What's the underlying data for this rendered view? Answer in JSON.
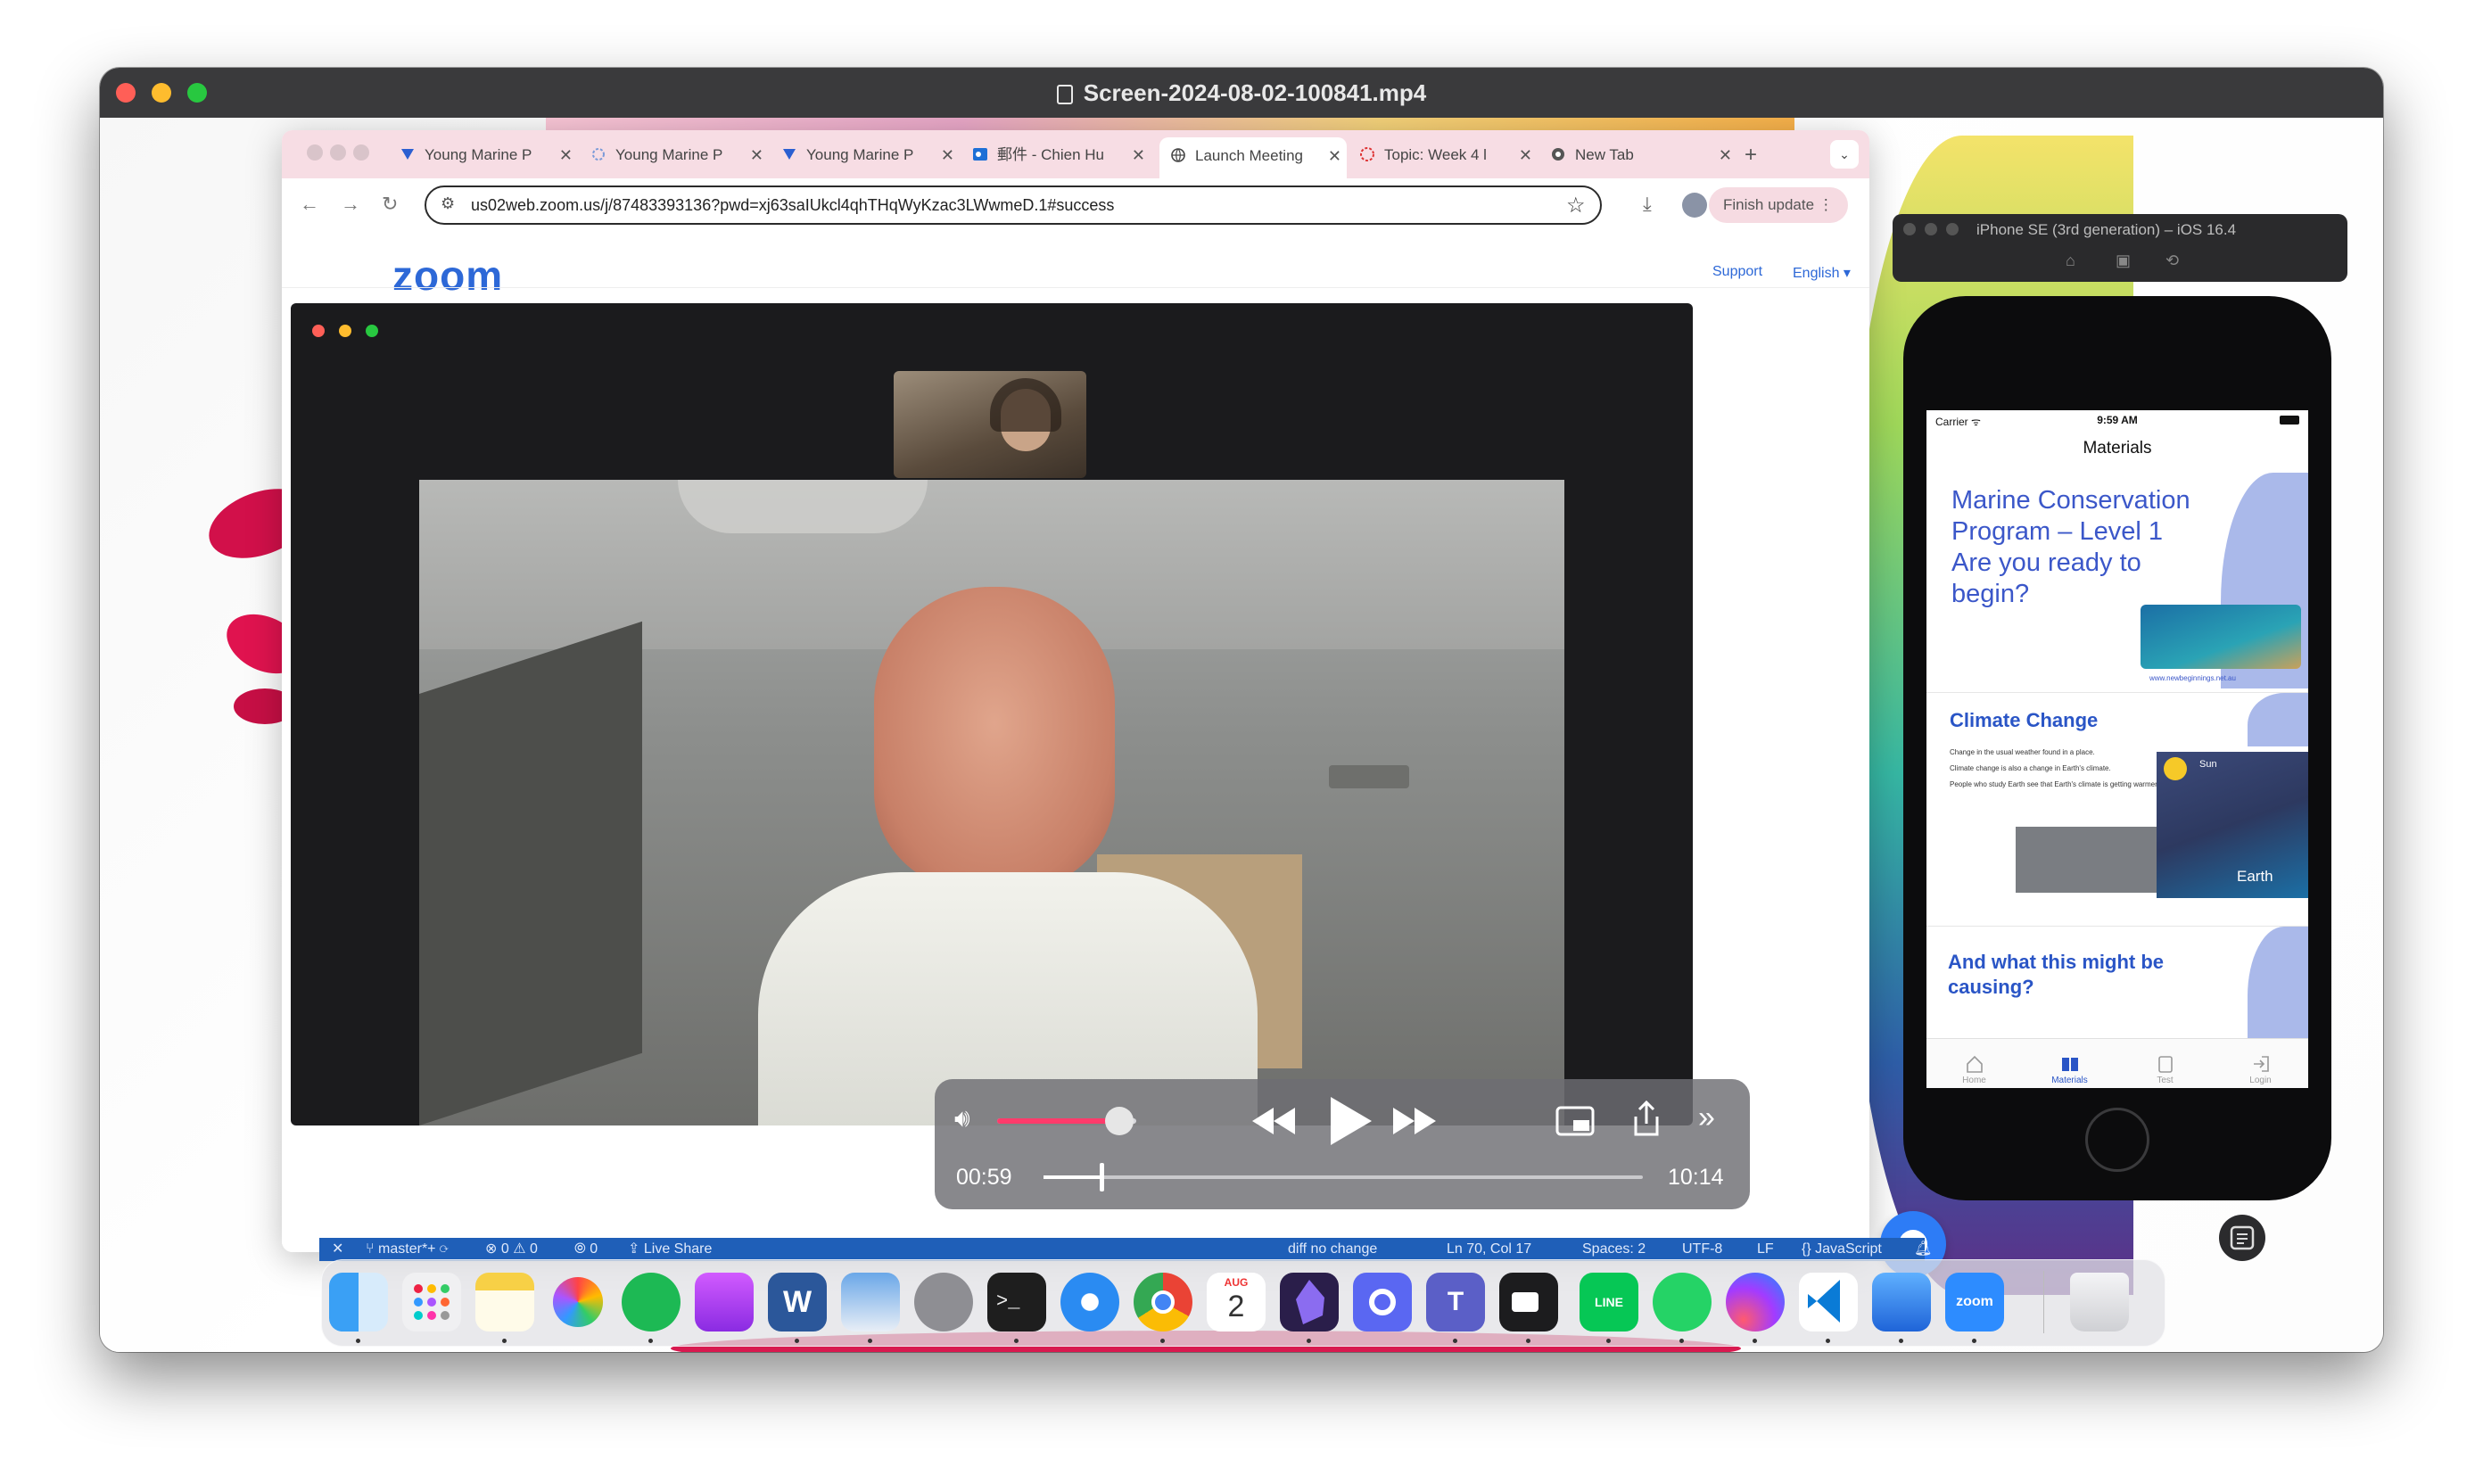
{
  "window": {
    "title": "Screen-2024-08-02-100841.mp4"
  },
  "browser": {
    "tabs": [
      {
        "label": "Young Marine P",
        "icon": "app-icon"
      },
      {
        "label": "Young Marine P",
        "icon": "app-icon"
      },
      {
        "label": "Young Marine P",
        "icon": "app-icon"
      },
      {
        "label": "郵件 - Chien Hu",
        "icon": "outlook-icon"
      },
      {
        "label": "Launch Meeting",
        "icon": "globe-icon"
      },
      {
        "label": "Topic: Week 4 l",
        "icon": "loading-icon"
      },
      {
        "label": "New Tab",
        "icon": "chrome-icon"
      }
    ],
    "url": "us02web.zoom.us/j/87483393136?pwd=xj63saIUkcl4qhTHqWyKzac3LWwmeD.1#success",
    "finish_update": "Finish update"
  },
  "zoom_page": {
    "logo": "zoom",
    "support": "Support",
    "language": "English"
  },
  "player": {
    "current_time": "00:59",
    "total_time": "10:14",
    "progress": 0.096,
    "volume": 0.88
  },
  "status_bar": {
    "branch": "master*+",
    "problems": "⊗ 0 ⚠ 0",
    "ports": "⦾ 0",
    "live_share": "Live Share",
    "diff": "diff no change",
    "cursor": "Ln 70, Col 17",
    "spaces": "Spaces: 2",
    "encoding": "UTF-8",
    "eol": "LF",
    "language": "JavaScript"
  },
  "simulator": {
    "title": "iPhone SE (3rd generation) – iOS 16.4",
    "status": {
      "carrier": "Carrier",
      "time": "9:59 AM"
    },
    "nav_title": "Materials",
    "cards": [
      {
        "title": "Marine Conservation Program – Level 1 Are you ready to begin?",
        "url": "www.newbeginnings.net.au"
      },
      {
        "title": "Climate Change",
        "bullets": [
          "Change in the usual weather found in a place.",
          "Climate change is also a change in Earth's climate.",
          "People who study Earth see that Earth's climate is getting warmer."
        ],
        "labels": {
          "sun": "Sun",
          "earth": "Earth"
        }
      },
      {
        "title": "And what this might be causing?"
      }
    ],
    "tab_items": [
      "Home",
      "Materials",
      "Test",
      "Login"
    ]
  },
  "dock_apps": [
    "Finder",
    "Launchpad",
    "Notes",
    "Photos",
    "Spotify",
    "Podcasts",
    "Word",
    "Preview",
    "System Settings",
    "Terminal",
    "Safari",
    "Chrome",
    "Calendar",
    "Obsidian",
    "Screen Recorder",
    "Teams",
    "Video Recorder",
    "LINE",
    "WhatsApp",
    "Messenger",
    "VS Code",
    "Xcode",
    "Zoom",
    "Trash"
  ],
  "calendar": {
    "month": "AUG",
    "day": "2"
  },
  "colors": {
    "accent": "#2d68d7",
    "tabbar": "#f7dde4",
    "statusbar": "#1f5fb8",
    "volume": "#ff3b6b"
  }
}
